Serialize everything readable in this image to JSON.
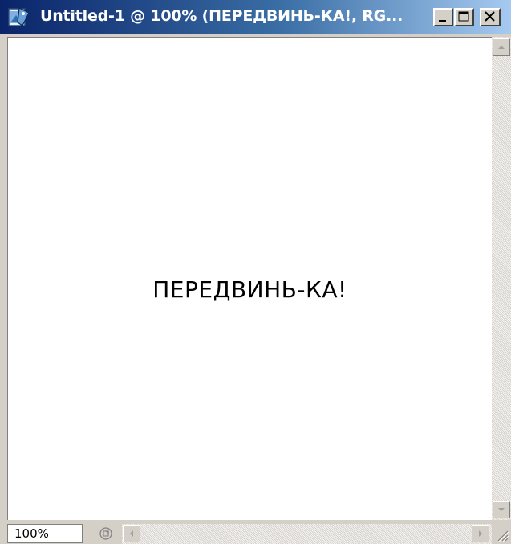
{
  "window": {
    "title": "Untitled-1 @ 100% (ПЕРЕДВИНЬ-КА!, RG...",
    "minimize_icon": "minimize-icon",
    "maximize_icon": "maximize-icon",
    "close_icon": "close-icon"
  },
  "canvas": {
    "text": "ПЕРЕДВИНЬ-КА!"
  },
  "status": {
    "zoom_value": "100%"
  },
  "colors": {
    "titlebar_start": "#0a246a",
    "titlebar_end": "#a6caf0",
    "chrome": "#d4d0c8",
    "canvas_bg": "#ffffff"
  }
}
